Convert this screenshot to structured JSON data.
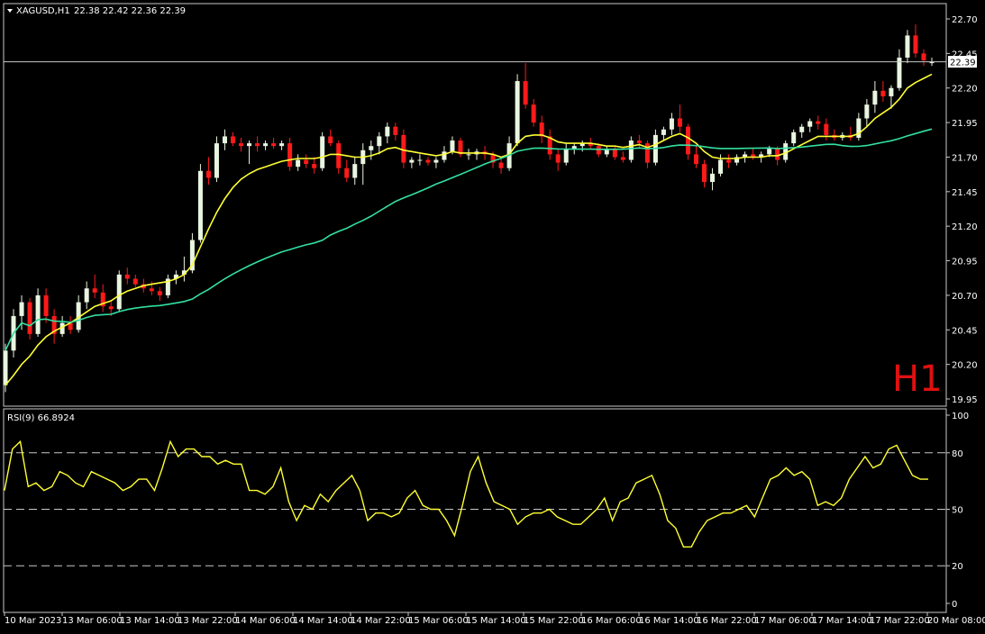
{
  "header": {
    "symbol": "XAGUSD,H1",
    "ohlc": "22.38 22.42 22.36 22.39",
    "dropdown_icon": "triangle-down-icon"
  },
  "timeframe_watermark": "H1",
  "colors": {
    "background": "#000000",
    "frame": "#c8c8c8",
    "bull_candle": "#e8f5e0",
    "bear_candle": "#ff1a1a",
    "ma_fast": "#ffff33",
    "ma_slow": "#33e0a0",
    "rsi_line": "#ffff33",
    "watermark": "#e01010",
    "text": "#ffffff",
    "price_tag_bg": "#ffffff",
    "price_tag_text": "#000000"
  },
  "chart_data": [
    {
      "type": "candlestick",
      "symbol": "XAGUSD",
      "timeframe": "H1",
      "price_axis_ticks": [
        22.7,
        22.45,
        22.2,
        21.95,
        21.7,
        21.45,
        21.2,
        20.95,
        20.7,
        20.45,
        20.2,
        19.95
      ],
      "price_axis_labels": [
        "22.70",
        "22.45",
        "22.20",
        "21.95",
        "21.70",
        "21.45",
        "21.20",
        "20.95",
        "20.70",
        "20.45",
        "20.20",
        "19.95"
      ],
      "ylim": [
        19.9,
        22.9
      ],
      "current_price": 22.39,
      "current_price_label": "22.39",
      "x_tick_labels": [
        "10 Mar 2023",
        "13 Mar 06:00",
        "13 Mar 14:00",
        "13 Mar 22:00",
        "14 Mar 06:00",
        "14 Mar 14:00",
        "14 Mar 22:00",
        "15 Mar 06:00",
        "15 Mar 14:00",
        "15 Mar 22:00",
        "16 Mar 06:00",
        "16 Mar 14:00",
        "16 Mar 22:00",
        "17 Mar 06:00",
        "17 Mar 14:00",
        "17 Mar 22:00",
        "20 Mar 08:00"
      ],
      "candles": [
        [
          20.05,
          20.35,
          20.0,
          20.3
        ],
        [
          20.3,
          20.6,
          20.25,
          20.55
        ],
        [
          20.55,
          20.7,
          20.45,
          20.65
        ],
        [
          20.65,
          20.68,
          20.38,
          20.42
        ],
        [
          20.42,
          20.75,
          20.4,
          20.7
        ],
        [
          20.7,
          20.75,
          20.5,
          20.55
        ],
        [
          20.55,
          20.6,
          20.35,
          20.42
        ],
        [
          20.42,
          20.55,
          20.4,
          20.5
        ],
        [
          20.5,
          20.55,
          20.42,
          20.45
        ],
        [
          20.45,
          20.7,
          20.43,
          20.65
        ],
        [
          20.65,
          20.8,
          20.6,
          20.75
        ],
        [
          20.75,
          20.85,
          20.68,
          20.72
        ],
        [
          20.72,
          20.78,
          20.58,
          20.62
        ],
        [
          20.62,
          20.66,
          20.55,
          20.6
        ],
        [
          20.6,
          20.88,
          20.58,
          20.85
        ],
        [
          20.85,
          20.9,
          20.78,
          20.82
        ],
        [
          20.82,
          20.85,
          20.76,
          20.78
        ],
        [
          20.78,
          20.82,
          20.72,
          20.75
        ],
        [
          20.75,
          20.8,
          20.7,
          20.73
        ],
        [
          20.73,
          20.76,
          20.66,
          20.7
        ],
        [
          20.7,
          20.85,
          20.68,
          20.82
        ],
        [
          20.82,
          20.88,
          20.78,
          20.85
        ],
        [
          20.85,
          20.98,
          20.8,
          20.88
        ],
        [
          20.88,
          21.15,
          20.86,
          21.1
        ],
        [
          21.1,
          21.65,
          21.08,
          21.6
        ],
        [
          21.6,
          21.7,
          21.5,
          21.55
        ],
        [
          21.55,
          21.85,
          21.52,
          21.8
        ],
        [
          21.8,
          21.9,
          21.75,
          21.85
        ],
        [
          21.85,
          21.88,
          21.78,
          21.8
        ],
        [
          21.8,
          21.84,
          21.74,
          21.78
        ],
        [
          21.78,
          21.82,
          21.65,
          21.8
        ],
        [
          21.8,
          21.85,
          21.74,
          21.78
        ],
        [
          21.78,
          21.82,
          21.75,
          21.8
        ],
        [
          21.8,
          21.84,
          21.76,
          21.78
        ],
        [
          21.78,
          21.82,
          21.75,
          21.8
        ],
        [
          21.8,
          21.84,
          21.6,
          21.63
        ],
        [
          21.63,
          21.72,
          21.6,
          21.68
        ],
        [
          21.68,
          21.72,
          21.62,
          21.65
        ],
        [
          21.65,
          21.7,
          21.58,
          21.62
        ],
        [
          21.62,
          21.88,
          21.6,
          21.85
        ],
        [
          21.85,
          21.9,
          21.78,
          21.8
        ],
        [
          21.8,
          21.82,
          21.58,
          21.62
        ],
        [
          21.62,
          21.68,
          21.52,
          21.55
        ],
        [
          21.55,
          21.7,
          21.5,
          21.65
        ],
        [
          21.65,
          21.8,
          21.5,
          21.75
        ],
        [
          21.75,
          21.82,
          21.68,
          21.78
        ],
        [
          21.78,
          21.88,
          21.72,
          21.85
        ],
        [
          21.85,
          21.95,
          21.8,
          21.92
        ],
        [
          21.92,
          21.95,
          21.82,
          21.86
        ],
        [
          21.86,
          21.9,
          21.62,
          21.66
        ],
        [
          21.66,
          21.7,
          21.62,
          21.68
        ],
        [
          21.68,
          21.72,
          21.64,
          21.68
        ],
        [
          21.68,
          21.7,
          21.64,
          21.66
        ],
        [
          21.66,
          21.7,
          21.62,
          21.68
        ],
        [
          21.68,
          21.78,
          21.66,
          21.74
        ],
        [
          21.74,
          21.85,
          21.72,
          21.82
        ],
        [
          21.82,
          21.84,
          21.7,
          21.72
        ],
        [
          21.72,
          21.76,
          21.68,
          21.72
        ],
        [
          21.72,
          21.76,
          21.68,
          21.74
        ],
        [
          21.74,
          21.78,
          21.68,
          21.72
        ],
        [
          21.72,
          21.74,
          21.62,
          21.66
        ],
        [
          21.66,
          21.7,
          21.58,
          21.62
        ],
        [
          21.62,
          21.85,
          21.6,
          21.8
        ],
        [
          21.8,
          22.3,
          21.78,
          22.25
        ],
        [
          22.25,
          22.38,
          22.05,
          22.08
        ],
        [
          22.08,
          22.12,
          21.92,
          21.95
        ],
        [
          21.95,
          22.0,
          21.8,
          21.85
        ],
        [
          21.85,
          21.9,
          21.68,
          21.72
        ],
        [
          21.72,
          21.76,
          21.6,
          21.66
        ],
        [
          21.66,
          21.8,
          21.64,
          21.76
        ],
        [
          21.76,
          21.8,
          21.72,
          21.78
        ],
        [
          21.78,
          21.82,
          21.74,
          21.8
        ],
        [
          21.8,
          21.84,
          21.76,
          21.78
        ],
        [
          21.78,
          21.8,
          21.7,
          21.72
        ],
        [
          21.72,
          21.78,
          21.7,
          21.76
        ],
        [
          21.76,
          21.78,
          21.68,
          21.7
        ],
        [
          21.7,
          21.74,
          21.66,
          21.68
        ],
        [
          21.68,
          21.85,
          21.66,
          21.82
        ],
        [
          21.82,
          21.86,
          21.76,
          21.8
        ],
        [
          21.8,
          21.82,
          21.62,
          21.66
        ],
        [
          21.66,
          21.9,
          21.64,
          21.86
        ],
        [
          21.86,
          21.92,
          21.82,
          21.9
        ],
        [
          21.9,
          22.02,
          21.86,
          21.98
        ],
        [
          21.98,
          22.08,
          21.88,
          21.92
        ],
        [
          21.92,
          21.94,
          21.68,
          21.72
        ],
        [
          21.72,
          21.78,
          21.62,
          21.65
        ],
        [
          21.65,
          21.68,
          21.48,
          21.52
        ],
        [
          21.52,
          21.62,
          21.46,
          21.58
        ],
        [
          21.58,
          21.72,
          21.56,
          21.68
        ],
        [
          21.68,
          21.72,
          21.62,
          21.66
        ],
        [
          21.66,
          21.72,
          21.64,
          21.7
        ],
        [
          21.7,
          21.74,
          21.66,
          21.72
        ],
        [
          21.72,
          21.76,
          21.68,
          21.7
        ],
        [
          21.7,
          21.74,
          21.66,
          21.72
        ],
        [
          21.72,
          21.78,
          21.7,
          21.76
        ],
        [
          21.76,
          21.78,
          21.64,
          21.68
        ],
        [
          21.68,
          21.82,
          21.66,
          21.8
        ],
        [
          21.8,
          21.9,
          21.78,
          21.88
        ],
        [
          21.88,
          21.94,
          21.84,
          21.92
        ],
        [
          21.92,
          21.98,
          21.88,
          21.96
        ],
        [
          21.96,
          22.0,
          21.9,
          21.94
        ],
        [
          21.94,
          21.98,
          21.82,
          21.86
        ],
        [
          21.86,
          21.9,
          21.82,
          21.84
        ],
        [
          21.84,
          21.88,
          21.82,
          21.86
        ],
        [
          21.86,
          21.92,
          21.82,
          21.84
        ],
        [
          21.84,
          22.02,
          21.82,
          21.98
        ],
        [
          21.98,
          22.12,
          21.92,
          22.08
        ],
        [
          22.08,
          22.25,
          22.02,
          22.18
        ],
        [
          22.18,
          22.25,
          22.1,
          22.14
        ],
        [
          22.14,
          22.22,
          22.05,
          22.2
        ],
        [
          22.2,
          22.48,
          22.18,
          22.42
        ],
        [
          22.42,
          22.62,
          22.38,
          22.58
        ],
        [
          22.58,
          22.66,
          22.42,
          22.45
        ],
        [
          22.45,
          22.48,
          22.36,
          22.4
        ],
        [
          22.38,
          22.42,
          22.36,
          22.39
        ]
      ],
      "ma_fast": [
        20.05,
        20.12,
        20.2,
        20.26,
        20.34,
        20.4,
        20.44,
        20.47,
        20.5,
        20.54,
        20.58,
        20.62,
        20.64,
        20.66,
        20.7,
        20.73,
        20.75,
        20.77,
        20.78,
        20.79,
        20.8,
        20.82,
        20.85,
        20.92,
        21.05,
        21.18,
        21.3,
        21.4,
        21.48,
        21.54,
        21.58,
        21.61,
        21.63,
        21.65,
        21.67,
        21.68,
        21.69,
        21.69,
        21.69,
        21.7,
        21.72,
        21.72,
        21.71,
        21.7,
        21.7,
        21.71,
        21.73,
        21.76,
        21.77,
        21.75,
        21.74,
        21.73,
        21.72,
        21.71,
        21.72,
        21.74,
        21.73,
        21.73,
        21.73,
        21.73,
        21.72,
        21.7,
        21.72,
        21.8,
        21.85,
        21.86,
        21.86,
        21.84,
        21.81,
        21.8,
        21.8,
        21.8,
        21.8,
        21.79,
        21.78,
        21.78,
        21.77,
        21.78,
        21.79,
        21.77,
        21.79,
        21.82,
        21.85,
        21.87,
        21.84,
        21.8,
        21.74,
        21.7,
        21.69,
        21.69,
        21.69,
        21.7,
        21.7,
        21.7,
        21.71,
        21.71,
        21.73,
        21.76,
        21.79,
        21.82,
        21.85,
        21.85,
        21.85,
        21.85,
        21.85,
        21.87,
        21.92,
        21.98,
        22.02,
        22.06,
        22.12,
        22.2,
        22.24,
        22.27,
        22.3
      ]
    },
    {
      "type": "line",
      "title": "RSI(9) 66.8924",
      "series_name": "RSI(9)",
      "current_value": 66.8924,
      "ylim": [
        0,
        100
      ],
      "y_tick_labels": [
        "100",
        "80",
        "50",
        "20",
        "0"
      ],
      "levels": [
        80,
        50,
        20
      ],
      "values": [
        60,
        82,
        86,
        62,
        64,
        60,
        62,
        70,
        68,
        64,
        62,
        70,
        68,
        66,
        64,
        60,
        62,
        66,
        66,
        60,
        72,
        86,
        78,
        82,
        82,
        78,
        78,
        74,
        76,
        74,
        74,
        60,
        60,
        58,
        62,
        72,
        54,
        44,
        52,
        50,
        58,
        54,
        60,
        64,
        68,
        60,
        44,
        48,
        48,
        46,
        48,
        56,
        60,
        52,
        50,
        50,
        44,
        36,
        52,
        70,
        78,
        64,
        54,
        52,
        50,
        42,
        46,
        48,
        48,
        50,
        46,
        44,
        42,
        42,
        46,
        50,
        56,
        44,
        54,
        56,
        64,
        66,
        68,
        58,
        44,
        40,
        30,
        30,
        38,
        44,
        46,
        48,
        48,
        50,
        52,
        46,
        56,
        66,
        68,
        72,
        68,
        70,
        66,
        52,
        54,
        52,
        56,
        66,
        72,
        78,
        72,
        74,
        82,
        84,
        76,
        68,
        66,
        66
      ]
    }
  ]
}
